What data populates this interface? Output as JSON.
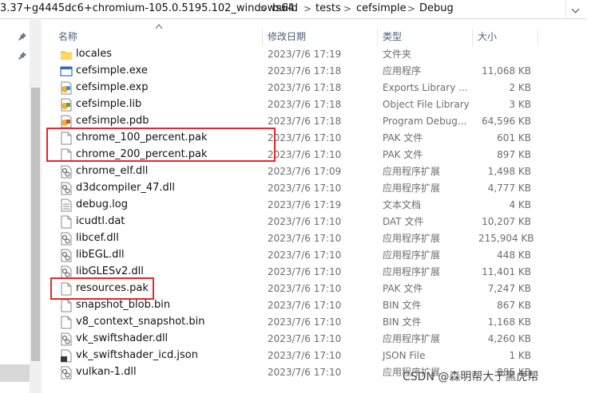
{
  "address_bar": {
    "crumbs": [
      "3.37+g4445dc6+chromium-105.0.5195.102_windows64",
      "build",
      "tests",
      "cefsimple",
      "Debug"
    ],
    "separator": ">"
  },
  "columns": {
    "name": "名称",
    "date": "修改日期",
    "type": "类型",
    "size": "大小"
  },
  "files": [
    {
      "name": "locales",
      "date": "2023/7/6 17:19",
      "type": "文件夹",
      "size": "",
      "icon": "folder-icon"
    },
    {
      "name": "cefsimple.exe",
      "date": "2023/7/6 17:18",
      "type": "应用程序",
      "size": "11,068 KB",
      "icon": "exe-icon"
    },
    {
      "name": "cefsimple.exp",
      "date": "2023/7/6 17:18",
      "type": "Exports Library ...",
      "size": "2 KB",
      "icon": "exp-icon"
    },
    {
      "name": "cefsimple.lib",
      "date": "2023/7/6 17:18",
      "type": "Object File Library",
      "size": "3 KB",
      "icon": "lib-icon"
    },
    {
      "name": "cefsimple.pdb",
      "date": "2023/7/6 17:18",
      "type": "Program Debug...",
      "size": "64,596 KB",
      "icon": "pdb-icon"
    },
    {
      "name": "chrome_100_percent.pak",
      "date": "2023/7/6 17:10",
      "type": "PAK 文件",
      "size": "601 KB",
      "icon": "file-icon"
    },
    {
      "name": "chrome_200_percent.pak",
      "date": "2023/7/6 17:10",
      "type": "PAK 文件",
      "size": "897 KB",
      "icon": "file-icon"
    },
    {
      "name": "chrome_elf.dll",
      "date": "2023/7/6 17:09",
      "type": "应用程序扩展",
      "size": "1,498 KB",
      "icon": "dll-icon"
    },
    {
      "name": "d3dcompiler_47.dll",
      "date": "2023/7/6 17:10",
      "type": "应用程序扩展",
      "size": "4,777 KB",
      "icon": "dll-icon"
    },
    {
      "name": "debug.log",
      "date": "2023/7/6 17:19",
      "type": "文本文档",
      "size": "4 KB",
      "icon": "text-file-icon"
    },
    {
      "name": "icudtl.dat",
      "date": "2023/7/6 17:10",
      "type": "DAT 文件",
      "size": "10,207 KB",
      "icon": "file-icon"
    },
    {
      "name": "libcef.dll",
      "date": "2023/7/6 17:10",
      "type": "应用程序扩展",
      "size": "215,904 KB",
      "icon": "dll-icon"
    },
    {
      "name": "libEGL.dll",
      "date": "2023/7/6 17:10",
      "type": "应用程序扩展",
      "size": "448 KB",
      "icon": "dll-icon"
    },
    {
      "name": "libGLESv2.dll",
      "date": "2023/7/6 17:10",
      "type": "应用程序扩展",
      "size": "11,401 KB",
      "icon": "dll-icon"
    },
    {
      "name": "resources.pak",
      "date": "2023/7/6 17:10",
      "type": "PAK 文件",
      "size": "7,247 KB",
      "icon": "file-icon"
    },
    {
      "name": "snapshot_blob.bin",
      "date": "2023/7/6 17:10",
      "type": "BIN 文件",
      "size": "867 KB",
      "icon": "file-icon"
    },
    {
      "name": "v8_context_snapshot.bin",
      "date": "2023/7/6 17:10",
      "type": "BIN 文件",
      "size": "1,168 KB",
      "icon": "file-icon"
    },
    {
      "name": "vk_swiftshader.dll",
      "date": "2023/7/6 17:10",
      "type": "应用程序扩展",
      "size": "4,260 KB",
      "icon": "dll-icon"
    },
    {
      "name": "vk_swiftshader_icd.json",
      "date": "2023/7/6 17:10",
      "type": "JSON File",
      "size": "1 KB",
      "icon": "json-icon"
    },
    {
      "name": "vulkan-1.dll",
      "date": "2023/7/6 17:10",
      "type": "应用程序扩展",
      "size": "885 KB",
      "icon": "dll-icon"
    }
  ],
  "watermark": "CSDN @森明帮大于黑虎帮",
  "colors": {
    "highlight": "#e8262b",
    "header_text": "#4c607a",
    "folder": "#f7c744"
  }
}
